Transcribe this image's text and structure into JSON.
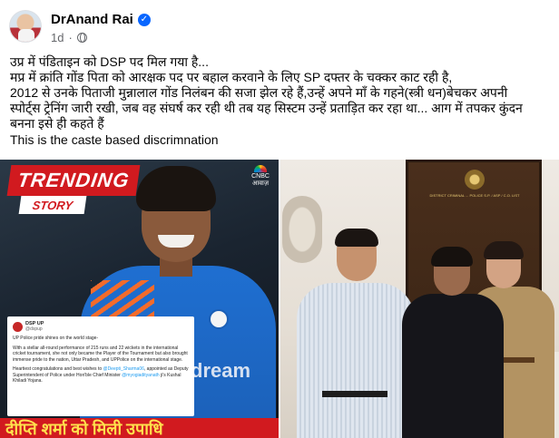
{
  "post": {
    "author": "DrAnand Rai",
    "time": "1d",
    "dot": "·",
    "verified": "✓"
  },
  "text": {
    "line1": "उप्र में पंडिताइन को DSP पद मिल गया है...",
    "line2": "मप्र में क्रांति गोंड पिता को आरक्षक पद पर बहाल करवाने के लिए SP दफ्तर के चक्कर काट रही है,",
    "line3": "2012 से उनके पिताजी मुन्नालाल गोंड निलंबन की सजा झेल रहे हैं,उन्हें अपने माँ के गहने(स्त्री धन)बेचकर अपनी",
    "line4": "स्पोर्ट्स ट्रेनिंग जारी रखी, जब वह संघर्ष कर रही थी तब यह सिस्टम उन्हें प्रताड़ित कर रहा था... आग में तपकर कुंदन",
    "line5": "बनना इसे ही कहते हैं",
    "line6": "This is the caste based discrimnation"
  },
  "media_left": {
    "badge_trending": "TRENDING",
    "badge_story": "STORY",
    "cnbc_label": "CNBC",
    "cnbc_sub": "आवाज़",
    "sponsor": "dream",
    "tweet": {
      "name": "DSP UP",
      "handle": "@dspup",
      "p1": "UP Police pride shines on the world stage-",
      "p2": "With a stellar all-round performance of 215 runs and 22 wickets in the international cricket tournament, she not only became the Player of the Tournament but also brought immense pride to the nation, Uttar Pradesh, and UPPolice on the international stage.",
      "p3a": "Heartiest congratulations and best wishes to ",
      "p3_link1": "@Deepti_Sharma06",
      "p3b": ", appointed as Deputy Superintendent of Police under Hon'ble Chief Minister ",
      "p3_link2": "@myogiadityanath",
      "p3c": " ji's Kushal Khiladi Yojana."
    },
    "hindi_strip": "दीप्ति शर्मा को मिली उपाधि"
  },
  "media_right": {
    "board_text": "DISTRICT CRIMINAL ... POLICE S.P. / ASP / C.O. LIST"
  }
}
